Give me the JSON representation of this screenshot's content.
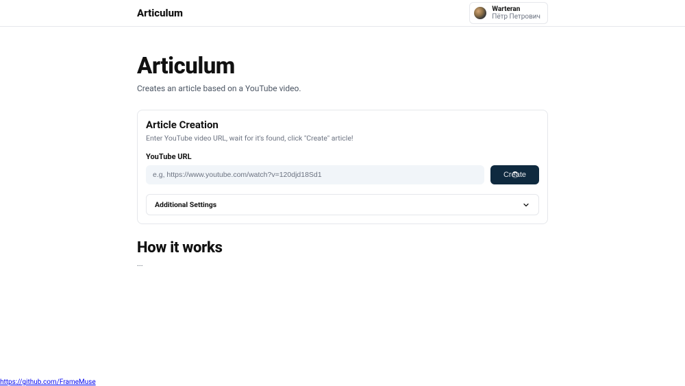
{
  "header": {
    "brand": "Articulum",
    "user": {
      "name": "Warteran",
      "subname": "Пётр Петрович"
    }
  },
  "page": {
    "title": "Articulum",
    "subtitle": "Creates an article based on a YouTube video."
  },
  "card": {
    "title": "Article Creation",
    "description": "Enter YouTube video URL, wait for it's found, click \"Create\" article!",
    "url_label": "YouTube URL",
    "url_placeholder": "e.g, https://www.youtube.com/watch?v=120djd18Sd1",
    "url_value": "",
    "create_label": "Create",
    "accordion_label": "Additional Settings"
  },
  "how_it_works": {
    "title": "How it works",
    "body": "..."
  },
  "footer": {
    "link_text": "https://github.com/FrameMuse"
  }
}
